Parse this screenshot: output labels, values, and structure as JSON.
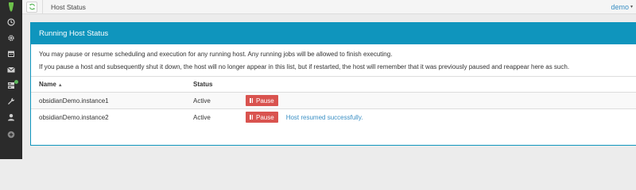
{
  "sidebar": {
    "items": [
      {
        "icon": "clock-icon"
      },
      {
        "icon": "gear-icon"
      },
      {
        "icon": "calendar-icon"
      },
      {
        "icon": "envelope-icon"
      },
      {
        "icon": "server-icon"
      },
      {
        "icon": "wrench-icon"
      },
      {
        "icon": "user-icon"
      },
      {
        "icon": "plus-circle-icon"
      }
    ]
  },
  "topbar": {
    "title": "Host Status",
    "user": "demo"
  },
  "panel": {
    "title": "Running Host Status",
    "paragraph1": "You may pause or resume scheduling and execution for any running host. Any running jobs will be allowed to finish executing.",
    "paragraph2": "If you pause a host and subsequently shut it down, the host will no longer appear in this list, but if restarted, the host will remember that it was previously paused and reappear here as such."
  },
  "table": {
    "headers": {
      "name": "Name",
      "status": "Status"
    },
    "rows": [
      {
        "name": "obsidianDemo.instance1",
        "status": "Active",
        "action": "Pause",
        "message": ""
      },
      {
        "name": "obsidianDemo.instance2",
        "status": "Active",
        "action": "Pause",
        "message": "Host resumed successfully."
      }
    ]
  },
  "colors": {
    "accent": "#0f95bd",
    "danger": "#d9534f",
    "link": "#3a8fc4",
    "sidebar": "#2b2b2b"
  }
}
